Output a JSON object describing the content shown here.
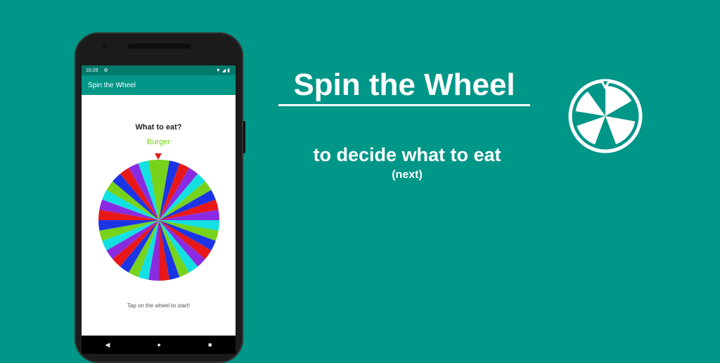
{
  "status_bar": {
    "time": "10:29",
    "icons": [
      "settings-icon",
      "wifi-icon",
      "signal-icon",
      "battery-icon"
    ]
  },
  "app_bar": {
    "title": "Spin the Wheel"
  },
  "screen": {
    "question": "What to eat?",
    "result": "Burger",
    "hint": "Tap on the wheel to start!"
  },
  "wheel": {
    "segment_colors": [
      "#ffffff",
      "#76d21b",
      "#1b35e6",
      "#e81818",
      "#8a2be2",
      "#13e0e0"
    ],
    "segment_count": 36,
    "pointer_color": "#e11c1c"
  },
  "nav_bar": {
    "icons": [
      "back-icon",
      "home-icon",
      "recents-icon"
    ]
  },
  "promo": {
    "headline": "Spin the Wheel",
    "subtitle": "to decide what to eat",
    "subtitle2": "(next)"
  },
  "colors": {
    "background": "#009688",
    "status_bar": "#00796b",
    "accent_text": "#76d21b"
  }
}
